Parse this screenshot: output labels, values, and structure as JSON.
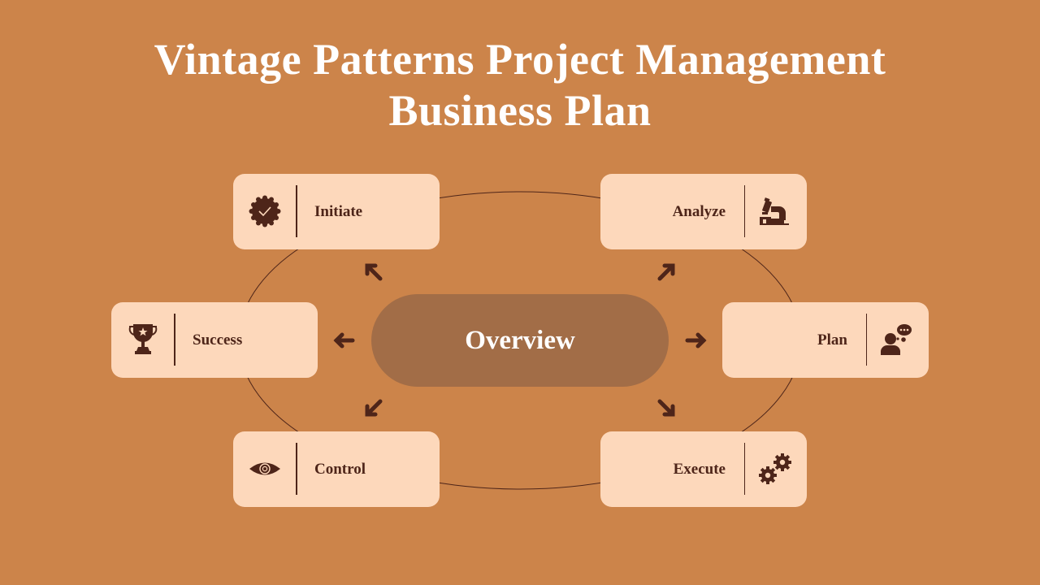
{
  "title": {
    "line1": "Vintage Patterns Project Management",
    "line2": "Business Plan"
  },
  "center": {
    "label": "Overview"
  },
  "cards": [
    {
      "id": "initiate",
      "label": "Initiate",
      "icon": "badge-check-icon"
    },
    {
      "id": "analyze",
      "label": "Analyze",
      "icon": "microscope-icon"
    },
    {
      "id": "success",
      "label": "Success",
      "icon": "trophy-icon"
    },
    {
      "id": "plan",
      "label": "Plan",
      "icon": "thinking-person-icon"
    },
    {
      "id": "control",
      "label": "Control",
      "icon": "eye-icon"
    },
    {
      "id": "execute",
      "label": "Execute",
      "icon": "gears-icon"
    }
  ],
  "colors": {
    "background": "#cc844a",
    "card": "#fdd8bb",
    "center": "#a26d47",
    "dark": "#4e2519",
    "title": "#ffffff"
  }
}
